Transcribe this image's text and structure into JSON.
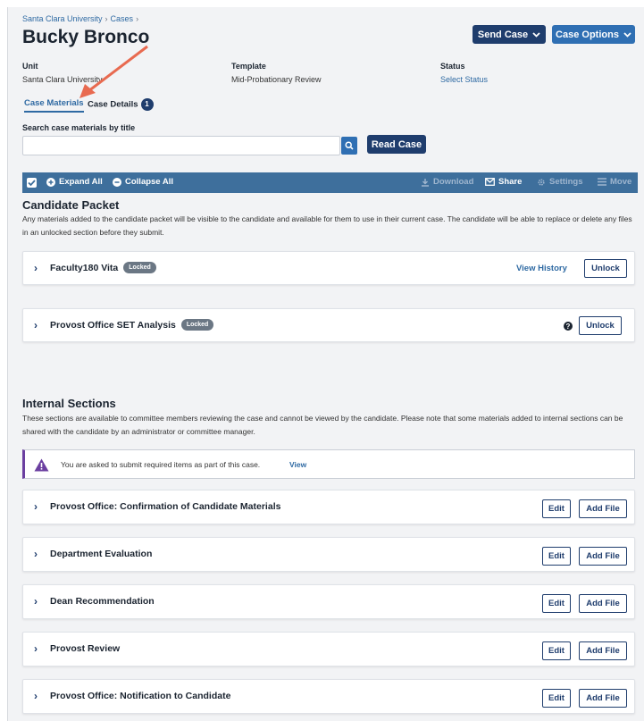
{
  "breadcrumb": {
    "root": "Santa Clara University",
    "sep1": "›",
    "cases": "Cases",
    "sep2": "›"
  },
  "page": {
    "title": "Bucky Bronco"
  },
  "header_buttons": {
    "send_case": "Send Case",
    "case_options": "Case Options"
  },
  "meta": {
    "unit_label": "Unit",
    "unit_value": "Santa Clara University",
    "template_label": "Template",
    "template_value": "Mid-Probationary Review",
    "status_label": "Status",
    "status_value": "Select Status"
  },
  "tabs": {
    "materials": "Case Materials",
    "details": "Case Details",
    "details_count": "1"
  },
  "search": {
    "label": "Search case materials by title",
    "placeholder": "",
    "read_case": "Read Case"
  },
  "toolbar": {
    "expand_all": "Expand All",
    "collapse_all": "Collapse All",
    "download": "Download",
    "share": "Share",
    "settings": "Settings",
    "move": "Move"
  },
  "candidate_packet": {
    "title": "Candidate Packet",
    "description": "Any materials added to the candidate packet will be visible to the candidate and available for them to use in their current case. The candidate will be able to replace or delete any files in an unlocked section before they submit.",
    "items": [
      {
        "title": "Faculty180 Vita",
        "badge": "Locked",
        "history": "View History",
        "action": "Unlock"
      },
      {
        "title": "Provost Office SET Analysis",
        "badge": "Locked",
        "action": "Unlock"
      }
    ]
  },
  "internal_sections": {
    "title": "Internal Sections",
    "description": "These sections are available to committee members reviewing the case and cannot be viewed by the candidate. Please note that some materials added to internal sections can be shared with the candidate by an administrator or committee manager.",
    "alert": {
      "text": "You are asked to submit required items as part of this case.",
      "link": "View"
    },
    "items": [
      {
        "title": "Provost Office: Confirmation of Candidate Materials",
        "edit": "Edit",
        "add": "Add File"
      },
      {
        "title": "Department Evaluation",
        "edit": "Edit",
        "add": "Add File"
      },
      {
        "title": "Dean Recommendation",
        "edit": "Edit",
        "add": "Add File"
      },
      {
        "title": "Provost Review",
        "edit": "Edit",
        "add": "Add File"
      },
      {
        "title": "Provost Office: Notification to Candidate",
        "edit": "Edit",
        "add": "Add File"
      }
    ]
  },
  "colors": {
    "navy": "#1f3d6d",
    "blue": "#2f6fb3",
    "toolbar": "#3e6f9c",
    "annotation_arrow": "#e86a50",
    "alert_accent": "#6b3fa0"
  }
}
